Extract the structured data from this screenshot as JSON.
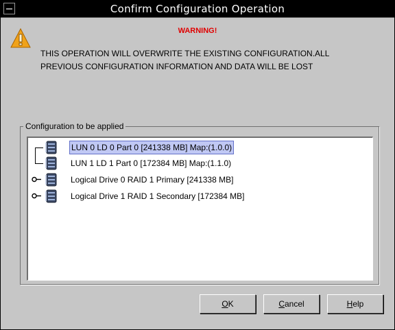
{
  "window": {
    "title": "Confirm Configuration Operation"
  },
  "warning": {
    "label": "WARNING!",
    "line1": "THIS OPERATION WILL OVERWRITE THE EXISTING CONFIGURATION.ALL",
    "line2": "PREVIOUS CONFIGURATION INFORMATION AND DATA WILL BE LOST"
  },
  "config_group": {
    "label": "Configuration to be applied"
  },
  "tree": {
    "items": [
      {
        "label": "LUN 0 LD 0 Part 0 [241338 MB] Map:(1.0.0)",
        "icon": "disk-icon",
        "selected": true,
        "expandable": false
      },
      {
        "label": "LUN 1 LD 1 Part 0 [172384 MB] Map:(1.1.0)",
        "icon": "disk-icon",
        "selected": false,
        "expandable": false
      },
      {
        "label": "Logical Drive 0 RAID 1 Primary [241338 MB]",
        "icon": "disk-icon",
        "selected": false,
        "expandable": true
      },
      {
        "label": "Logical Drive 1 RAID 1 Secondary [172384 MB]",
        "icon": "disk-icon",
        "selected": false,
        "expandable": true
      }
    ]
  },
  "buttons": {
    "ok": {
      "mnemonic": "O",
      "rest": "K"
    },
    "cancel": {
      "mnemonic": "C",
      "rest": "ancel"
    },
    "help": {
      "mnemonic": "H",
      "rest": "elp"
    }
  },
  "colors": {
    "titlebar": "#000000",
    "dialog_bg": "#c6c6c6",
    "warning_red": "#e00000",
    "selection": "#c0c8f4"
  }
}
